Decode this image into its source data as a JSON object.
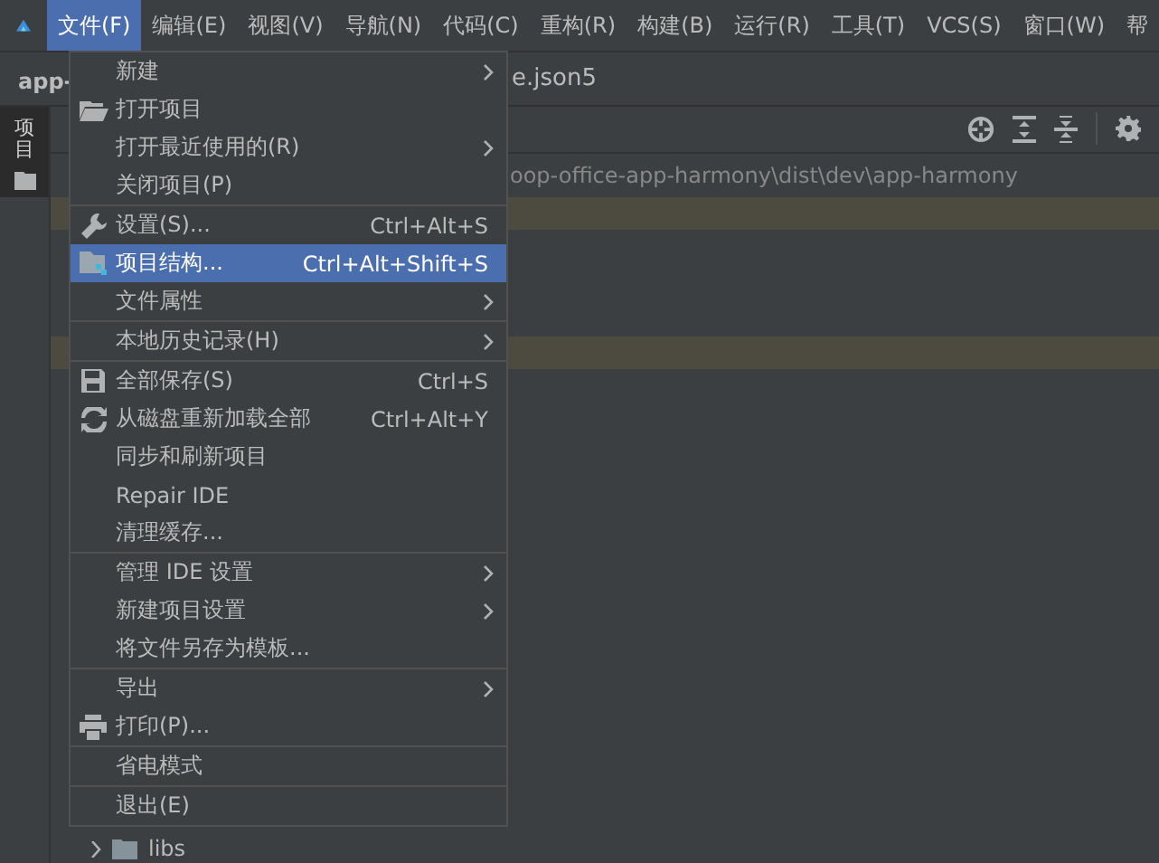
{
  "menubar": [
    {
      "label": "文件(F)",
      "selected": true
    },
    {
      "label": "编辑(E)",
      "selected": false
    },
    {
      "label": "视图(V)",
      "selected": false
    },
    {
      "label": "导航(N)",
      "selected": false
    },
    {
      "label": "代码(C)",
      "selected": false
    },
    {
      "label": "重构(R)",
      "selected": false
    },
    {
      "label": "构建(B)",
      "selected": false
    },
    {
      "label": "运行(R)",
      "selected": false
    },
    {
      "label": "工具(T)",
      "selected": false
    },
    {
      "label": "VCS(S)",
      "selected": false
    },
    {
      "label": "窗口(W)",
      "selected": false
    },
    {
      "label": "帮",
      "selected": false
    }
  ],
  "project_title": "app-",
  "editor_tab": "e.json5",
  "side_tab": "项目",
  "path": "oop-office-app-harmony\\dist\\dev\\app-harmony",
  "tree_row": "libs",
  "menu": [
    [
      {
        "label": "新建",
        "kind": "plain",
        "submenu": true,
        "selected": false
      },
      {
        "label": "打开项目",
        "kind": "open",
        "submenu": false,
        "selected": false
      },
      {
        "label": "打开最近使用的(R)",
        "kind": "plain",
        "submenu": true,
        "selected": false
      },
      {
        "label": "关闭项目(P)",
        "kind": "plain",
        "submenu": false,
        "selected": false
      }
    ],
    [
      {
        "label": "设置(S)...",
        "shortcut": "Ctrl+Alt+S",
        "kind": "settings",
        "submenu": false,
        "selected": false
      },
      {
        "label": "项目结构...",
        "shortcut": "Ctrl+Alt+Shift+S",
        "kind": "structure",
        "submenu": false,
        "selected": true
      },
      {
        "label": "文件属性",
        "kind": "plain",
        "submenu": true,
        "selected": false
      }
    ],
    [
      {
        "label": "本地历史记录(H)",
        "kind": "plain",
        "submenu": true,
        "selected": false
      }
    ],
    [
      {
        "label": "全部保存(S)",
        "shortcut": "Ctrl+S",
        "kind": "save",
        "submenu": false,
        "selected": false
      },
      {
        "label": "从磁盘重新加载全部",
        "shortcut": "Ctrl+Alt+Y",
        "kind": "reload",
        "submenu": false,
        "selected": false
      },
      {
        "label": "同步和刷新项目",
        "kind": "plain",
        "submenu": false,
        "selected": false
      },
      {
        "label": "Repair IDE",
        "kind": "plain",
        "submenu": false,
        "selected": false
      },
      {
        "label": "清理缓存...",
        "kind": "plain",
        "submenu": false,
        "selected": false
      }
    ],
    [
      {
        "label": "管理 IDE 设置",
        "kind": "plain",
        "submenu": true,
        "selected": false
      },
      {
        "label": "新建项目设置",
        "kind": "plain",
        "submenu": true,
        "selected": false
      },
      {
        "label": "将文件另存为模板...",
        "kind": "plain",
        "submenu": false,
        "selected": false
      }
    ],
    [
      {
        "label": "导出",
        "kind": "plain",
        "submenu": true,
        "selected": false
      },
      {
        "label": "打印(P)...",
        "kind": "print",
        "submenu": false,
        "selected": false
      }
    ],
    [
      {
        "label": "省电模式",
        "kind": "plain",
        "submenu": false,
        "selected": false
      }
    ],
    [
      {
        "label": "退出(E)",
        "kind": "plain",
        "submenu": false,
        "selected": false
      }
    ]
  ]
}
